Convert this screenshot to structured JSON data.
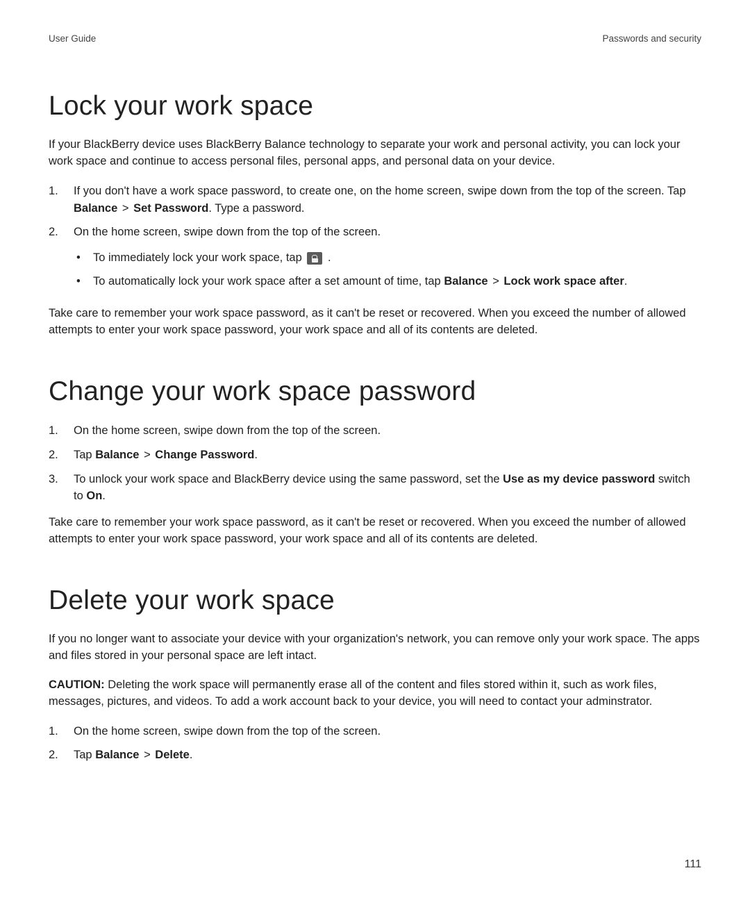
{
  "header": {
    "left": "User Guide",
    "right": "Passwords and security"
  },
  "page_number": "111",
  "sections": {
    "lock": {
      "title": "Lock your work space",
      "intro": "If your BlackBerry device uses BlackBerry Balance technology to separate your work and personal activity, you can lock your work space and continue to access personal files, personal apps, and personal data on your device.",
      "step1_a": "If you don't have a work space password, to create one, on the home screen, swipe down from the top of the screen. Tap ",
      "step1_b1": "Balance",
      "step1_sep": " > ",
      "step1_b2": "Set Password",
      "step1_c": ". Type a password.",
      "step2": "On the home screen, swipe down from the top of the screen.",
      "sub1": "To immediately lock your work space, tap ",
      "sub1_end": " .",
      "sub2_a": "To automatically lock your work space after a set amount of time, tap ",
      "sub2_b1": "Balance",
      "sub2_sep": " > ",
      "sub2_b2": "Lock work space after",
      "sub2_c": ".",
      "note": "Take care to remember your work space password, as it can't be reset or recovered. When you exceed the number of allowed attempts to enter your work space password, your work space and all of its contents are deleted."
    },
    "change": {
      "title": "Change your work space password",
      "step1": "On the home screen, swipe down from the top of the screen.",
      "step2_a": "Tap ",
      "step2_b1": "Balance",
      "step2_sep": " > ",
      "step2_b2": "Change Password",
      "step2_c": ".",
      "step3_a": "To unlock your work space and BlackBerry device using the same password, set the ",
      "step3_b": "Use as my device password",
      "step3_c": " switch to ",
      "step3_d": "On",
      "step3_e": ".",
      "note": "Take care to remember your work space password, as it can't be reset or recovered. When you exceed the number of allowed attempts to enter your work space password, your work space and all of its contents are deleted."
    },
    "delete": {
      "title": "Delete your work space",
      "intro": "If you no longer want to associate your device with your organization's network, you can remove only your work space. The apps and files stored in your personal space are left intact.",
      "caution_label": "CAUTION:",
      "caution_body": " Deleting the work space will permanently erase all of the content and files stored within it, such as work files, messages, pictures, and videos. To add a work account back to your device, you will need to contact your adminstrator.",
      "step1": "On the home screen, swipe down from the top of the screen.",
      "step2_a": "Tap ",
      "step2_b1": "Balance",
      "step2_sep": " > ",
      "step2_b2": "Delete",
      "step2_c": "."
    }
  },
  "list_numbers": {
    "n1": "1.",
    "n2": "2.",
    "n3": "3."
  },
  "bullet": "•"
}
